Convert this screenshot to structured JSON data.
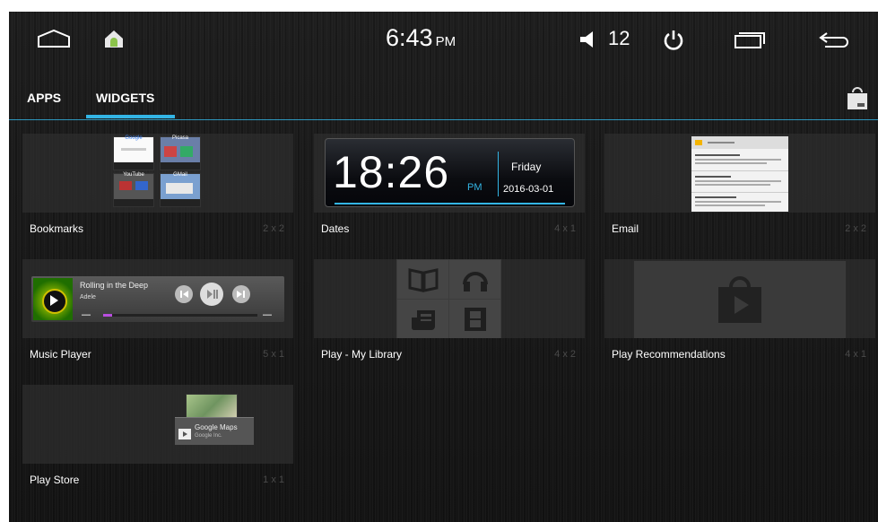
{
  "status_bar": {
    "time": "6:43",
    "ampm": "PM",
    "volume": "12",
    "icons": [
      "home-outline-icon",
      "android-home-icon",
      "volume-icon",
      "power-icon",
      "recent-apps-icon",
      "back-icon"
    ]
  },
  "tabs": [
    {
      "label": "APPS"
    },
    {
      "label": "WIDGETS",
      "selected": true
    }
  ],
  "accent_color": "#33b5e5",
  "widgets": [
    {
      "label": "Bookmarks",
      "size": "2 x 2"
    },
    {
      "label": "Dates",
      "size": "4 x 1"
    },
    {
      "label": "Email",
      "size": "2 x 2"
    },
    {
      "label": "Music Player",
      "size": "5 x 1"
    },
    {
      "label": "Play - My Library",
      "size": "4 x 2"
    },
    {
      "label": "Play Recommendations",
      "size": "4 x 1"
    },
    {
      "label": "Play Store",
      "size": "1 x 1"
    }
  ],
  "clock_widget": {
    "time": "18:26",
    "ampm": "PM",
    "day": "Friday",
    "date": "2016-03-01"
  },
  "music_widget": {
    "song": "Rolling in the Deep",
    "artist": "Adele",
    "progress": 0.06
  },
  "bookmarks_widget": {
    "tiles": [
      "Google",
      "Picasa",
      "YouTube",
      "GMail"
    ]
  },
  "store_widget": {
    "title": "Google Maps",
    "publisher": "Google Inc."
  }
}
